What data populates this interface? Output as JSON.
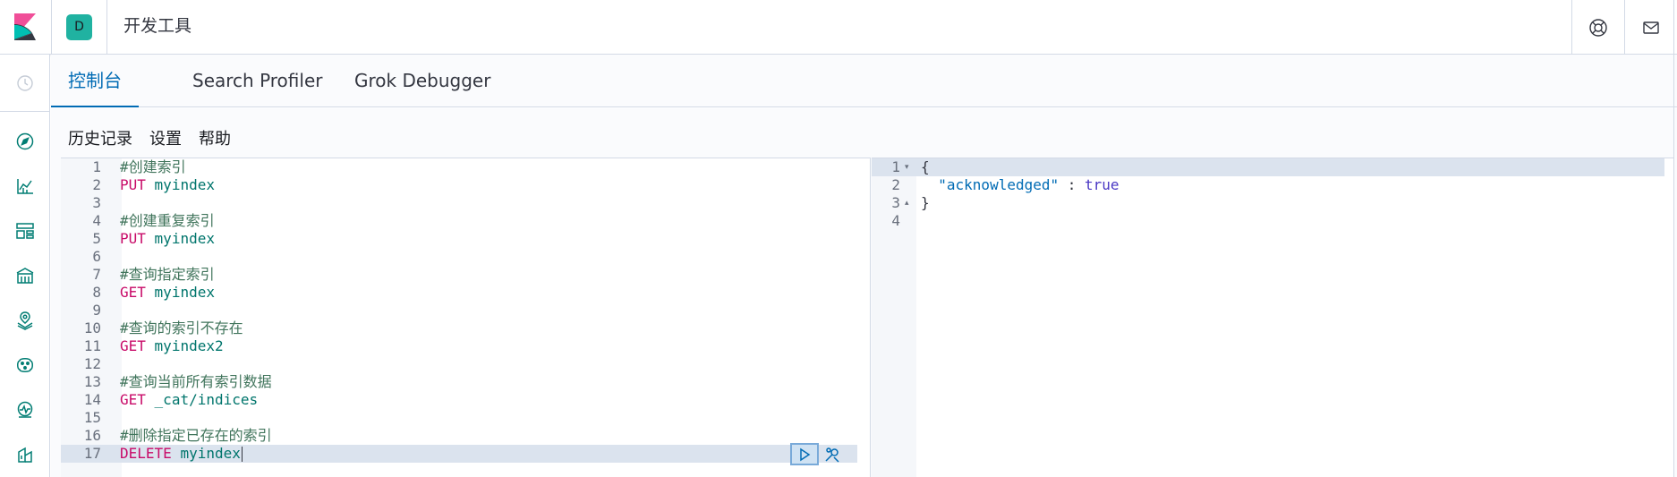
{
  "header": {
    "space_initial": "D",
    "app_title": "开发工具"
  },
  "tabs": [
    {
      "label": "控制台",
      "active": true
    },
    {
      "label": "Search Profiler",
      "active": false
    },
    {
      "label": "Grok Debugger",
      "active": false
    }
  ],
  "menu": {
    "history": "历史记录",
    "settings": "设置",
    "help": "帮助"
  },
  "editor": {
    "line_numbers": [
      "1",
      "2",
      "3",
      "4",
      "5",
      "6",
      "7",
      "8",
      "9",
      "10",
      "11",
      "12",
      "13",
      "14",
      "15",
      "16",
      "17"
    ],
    "lines": [
      {
        "kind": "comment",
        "text": "#创建索引"
      },
      {
        "kind": "request",
        "method": "PUT",
        "path": "myindex"
      },
      {
        "kind": "blank",
        "text": ""
      },
      {
        "kind": "comment",
        "text": "#创建重复索引"
      },
      {
        "kind": "request",
        "method": "PUT",
        "path": "myindex"
      },
      {
        "kind": "blank",
        "text": ""
      },
      {
        "kind": "comment",
        "text": "#查询指定索引"
      },
      {
        "kind": "request",
        "method": "GET",
        "path": "myindex"
      },
      {
        "kind": "blank",
        "text": ""
      },
      {
        "kind": "comment",
        "text": "#查询的索引不存在"
      },
      {
        "kind": "request",
        "method": "GET",
        "path": "myindex2"
      },
      {
        "kind": "blank",
        "text": ""
      },
      {
        "kind": "comment",
        "text": "#查询当前所有索引数据"
      },
      {
        "kind": "request",
        "method": "GET",
        "path": "_cat/indices"
      },
      {
        "kind": "blank",
        "text": ""
      },
      {
        "kind": "comment",
        "text": "#删除指定已存在的索引"
      },
      {
        "kind": "request",
        "method": "DELETE",
        "path": "myindex"
      }
    ]
  },
  "output": {
    "line_numbers": [
      "1",
      "2",
      "3",
      "4"
    ],
    "open_brace": "{",
    "key": "\"acknowledged\"",
    "separator": " : ",
    "value": "true",
    "close_brace": "}"
  },
  "colors": {
    "accent": "#006bb4",
    "method": "#c80a68",
    "path": "#00756c",
    "comment": "#41755c",
    "space_avatar": "#20b2a1"
  },
  "icons": {
    "header_right": [
      "help-lifebuoy-icon",
      "mail-icon"
    ],
    "sidenav": [
      "clock-icon",
      "compass-icon",
      "visualize-icon",
      "dashboard-icon",
      "canvas-icon",
      "maps-icon",
      "ml-icon",
      "uptime-icon",
      "apm-icon"
    ],
    "editor_actions": [
      "play-icon",
      "wrench-icon"
    ]
  }
}
